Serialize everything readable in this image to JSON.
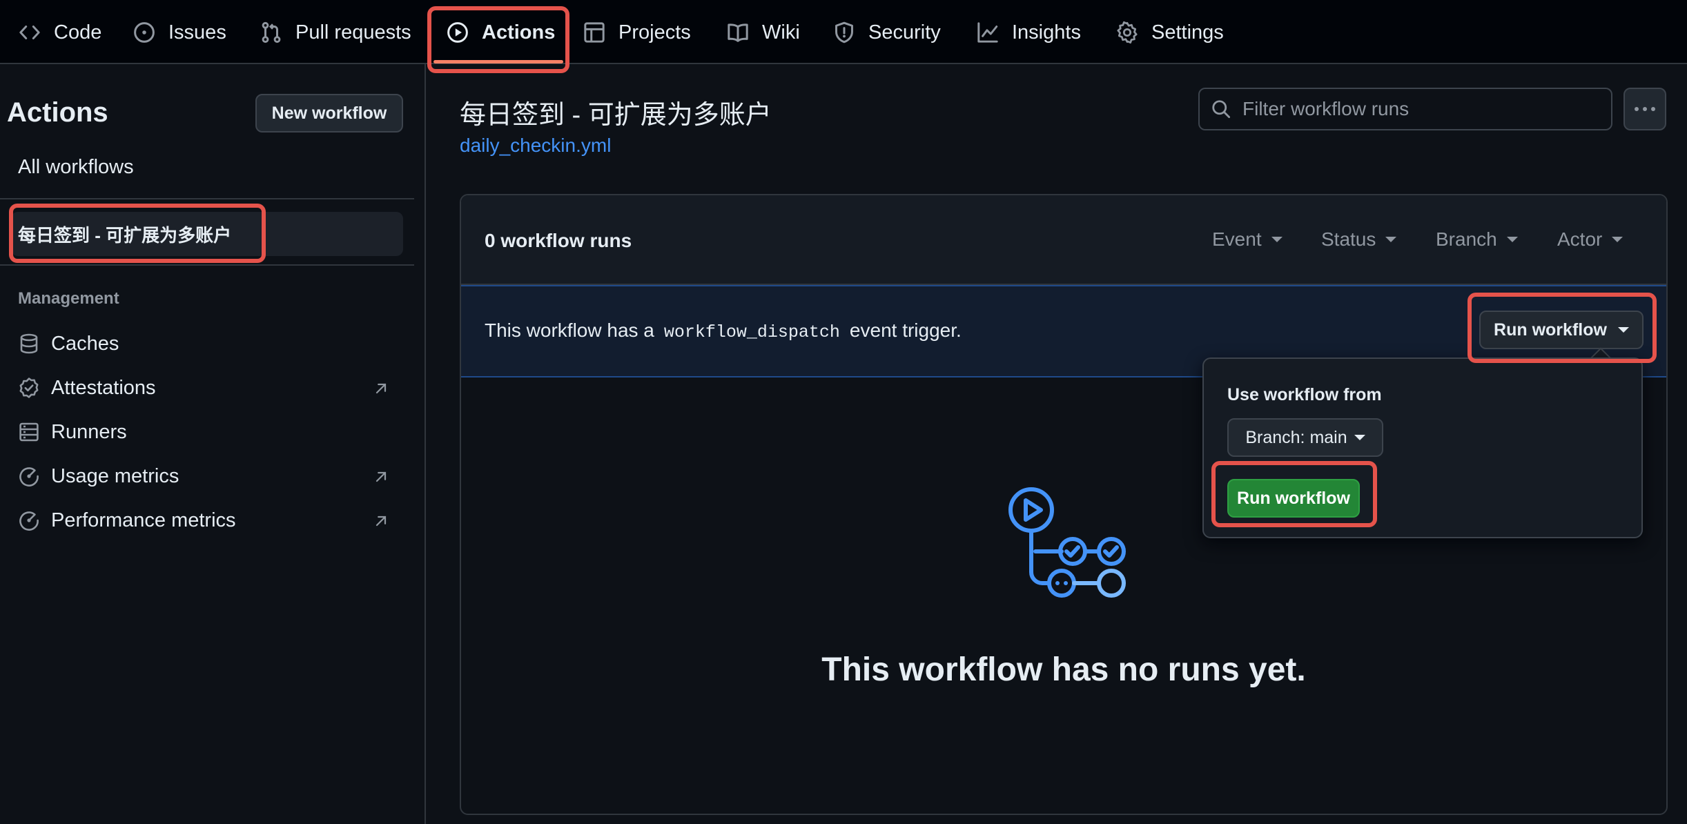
{
  "nav": {
    "tabs": [
      {
        "label": "Code",
        "icon": "code-icon"
      },
      {
        "label": "Issues",
        "icon": "issue-icon"
      },
      {
        "label": "Pull requests",
        "icon": "pull-request-icon"
      },
      {
        "label": "Actions",
        "icon": "play-icon",
        "active": true
      },
      {
        "label": "Projects",
        "icon": "table-icon"
      },
      {
        "label": "Wiki",
        "icon": "book-icon"
      },
      {
        "label": "Security",
        "icon": "shield-icon"
      },
      {
        "label": "Insights",
        "icon": "graph-icon"
      },
      {
        "label": "Settings",
        "icon": "gear-icon"
      }
    ]
  },
  "sidebar": {
    "title": "Actions",
    "new_workflow_label": "New workflow",
    "all_workflows_label": "All workflows",
    "workflow_item": "每日签到 - 可扩展为多账户",
    "management_label": "Management",
    "management_items": [
      {
        "label": "Caches",
        "icon": "database-icon",
        "external": false
      },
      {
        "label": "Attestations",
        "icon": "verified-icon",
        "external": true
      },
      {
        "label": "Runners",
        "icon": "server-icon",
        "external": false
      },
      {
        "label": "Usage metrics",
        "icon": "meter-icon",
        "external": true
      },
      {
        "label": "Performance metrics",
        "icon": "meter-icon",
        "external": true
      }
    ]
  },
  "main": {
    "workflow_title": "每日签到 - 可扩展为多账户",
    "workflow_file": "daily_checkin.yml",
    "filter_placeholder": "Filter workflow runs",
    "runs_count_label": "0 workflow runs",
    "filters": [
      "Event",
      "Status",
      "Branch",
      "Actor"
    ],
    "dispatch_prefix": "This workflow has a",
    "dispatch_code": "workflow_dispatch",
    "dispatch_suffix": "event trigger.",
    "run_workflow_label": "Run workflow",
    "empty_title": "This workflow has no runs yet."
  },
  "dropdown": {
    "label": "Use workflow from",
    "branch_label": "Branch: main",
    "run_button_label": "Run workflow"
  },
  "colors": {
    "background": "#0d1117",
    "accent_underline": "#f78166",
    "link": "#4493f8",
    "run_green": "#238636",
    "annotation_red": "#e5534b"
  }
}
